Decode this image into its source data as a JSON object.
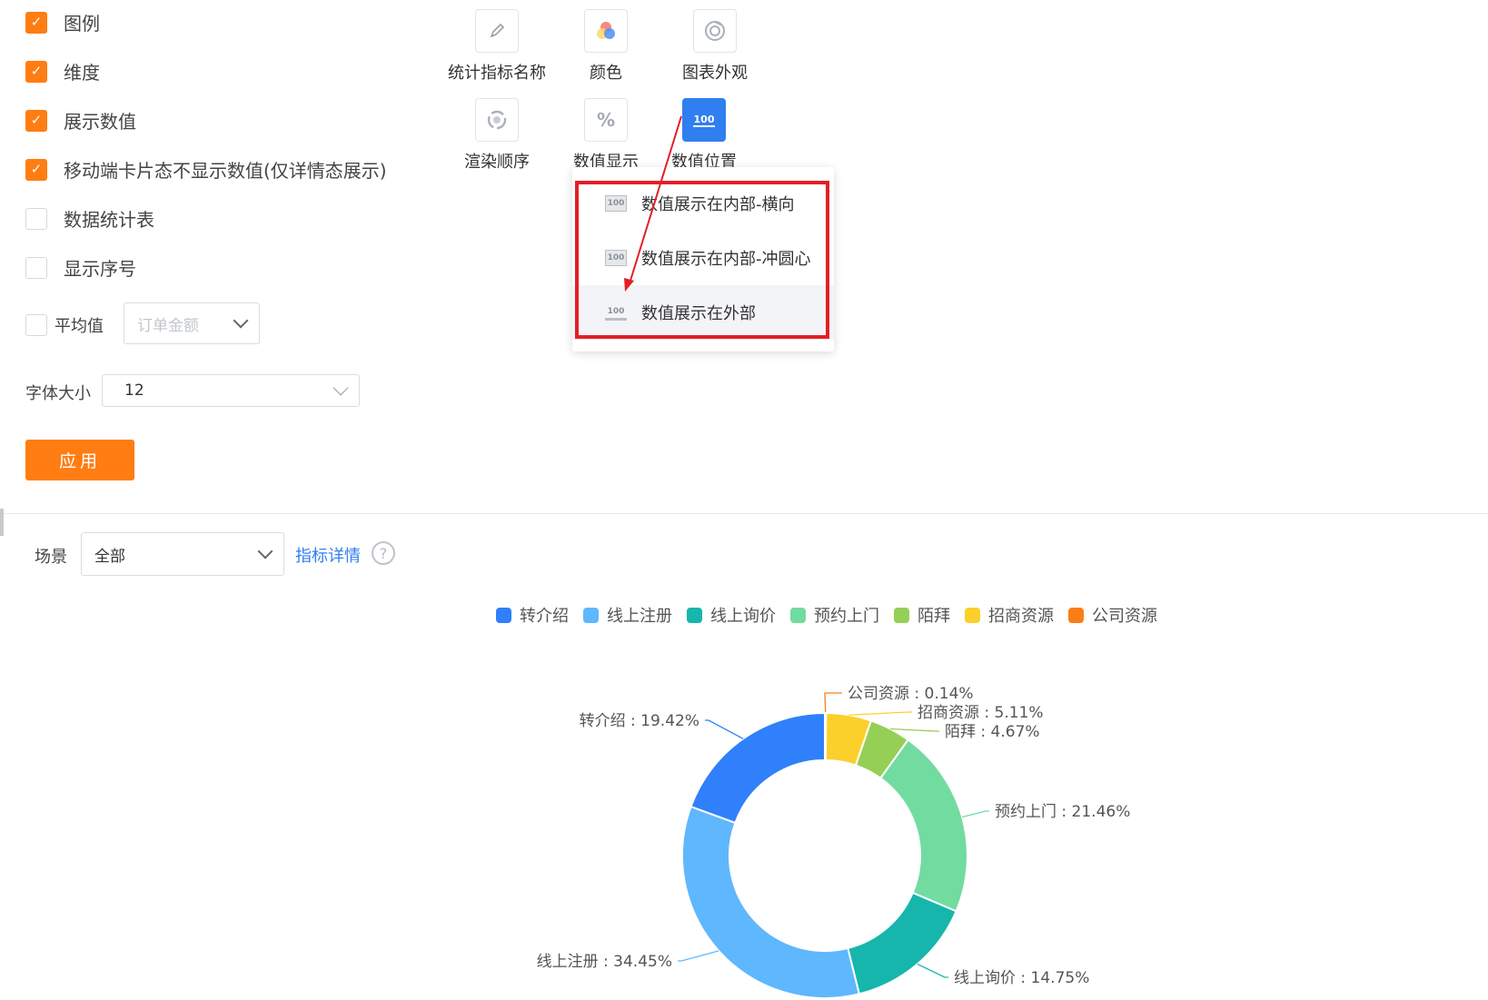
{
  "checkboxes": [
    {
      "label": "图例",
      "checked": true
    },
    {
      "label": "维度",
      "checked": true
    },
    {
      "label": "展示数值",
      "checked": true
    },
    {
      "label": "移动端卡片态不显示数值(仅详情态展示)",
      "checked": true
    },
    {
      "label": "数据统计表",
      "checked": false
    },
    {
      "label": "显示序号",
      "checked": false
    }
  ],
  "average": {
    "label": "平均值",
    "checked": false,
    "placeholder": "订单金额"
  },
  "font_size": {
    "label": "字体大小",
    "value": "12"
  },
  "apply_label": "应用",
  "tools": [
    {
      "label": "统计指标名称",
      "icon": "pencil-icon"
    },
    {
      "label": "颜色",
      "icon": "color-palette-icon"
    },
    {
      "label": "图表外观",
      "icon": "chart-style-icon"
    },
    {
      "label": "渲染顺序",
      "icon": "render-order-icon"
    },
    {
      "label": "数值显示",
      "icon": "percent-icon",
      "glyph": "%"
    },
    {
      "label": "数值位置",
      "icon": "value-position-icon",
      "glyph": "100",
      "active": true
    }
  ],
  "dropdown": {
    "items": [
      {
        "label": "数值展示在内部-横向",
        "icon_text": "100"
      },
      {
        "label": "数值展示在内部-冲圆心",
        "icon_text": "100"
      },
      {
        "label": "数值展示在外部",
        "icon_text": "100"
      }
    ],
    "hovered_index": 2
  },
  "scene": {
    "label": "场景",
    "value": "全部"
  },
  "link_label": "指标详情",
  "help_glyph": "?",
  "colors": {
    "accent": "#ff7d12",
    "primary": "#2f7ff0",
    "highlight": "#e41e26"
  },
  "chart_data": {
    "type": "pie",
    "donut": true,
    "legend_position": "top-center",
    "slices": [
      {
        "name": "公司资源",
        "value": 0.14,
        "label": "公司资源 : 0.14%",
        "color": "#fa7e17"
      },
      {
        "name": "招商资源",
        "value": 5.11,
        "label": "招商资源 : 5.11%",
        "color": "#fbd02b"
      },
      {
        "name": "陌拜",
        "value": 4.67,
        "label": "陌拜 : 4.67%",
        "color": "#96cf55"
      },
      {
        "name": "预约上门",
        "value": 21.46,
        "label": "预约上门 : 21.46%",
        "color": "#72dba0"
      },
      {
        "name": "线上询价",
        "value": 14.75,
        "label": "线上询价 : 14.75%",
        "color": "#16b6ad"
      },
      {
        "name": "线上注册",
        "value": 34.45,
        "label": "线上注册 : 34.45%",
        "color": "#5fb7fe"
      },
      {
        "name": "转介绍",
        "value": 19.42,
        "label": "转介绍 : 19.42%",
        "color": "#2f80fa"
      }
    ],
    "legend_order": [
      "转介绍",
      "线上注册",
      "线上询价",
      "预约上门",
      "陌拜",
      "招商资源",
      "公司资源"
    ]
  }
}
